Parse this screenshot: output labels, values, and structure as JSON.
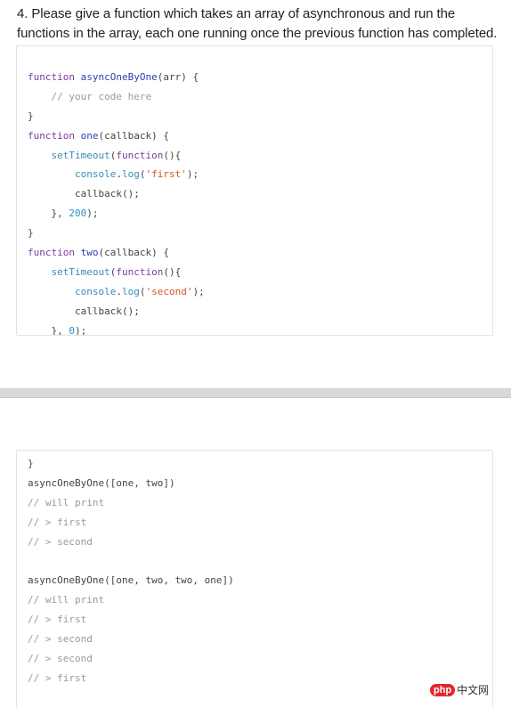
{
  "question": {
    "text": "4. Please give a function which takes an array of asynchronous and run the functions in the array, each one running once the previous function has completed."
  },
  "code_top": [
    [
      {
        "t": "kw",
        "v": "function "
      },
      {
        "t": "fn",
        "v": "asyncOneByOne"
      },
      {
        "t": "plain",
        "v": "(arr) {"
      }
    ],
    [
      {
        "t": "cm",
        "v": "    // your code here"
      }
    ],
    [
      {
        "t": "plain",
        "v": "}"
      }
    ],
    [
      {
        "t": "kw",
        "v": "function "
      },
      {
        "t": "fn",
        "v": "one"
      },
      {
        "t": "plain",
        "v": "(callback) {"
      }
    ],
    [
      {
        "t": "call",
        "v": "    setTimeout"
      },
      {
        "t": "plain",
        "v": "("
      },
      {
        "t": "kw",
        "v": "function"
      },
      {
        "t": "plain",
        "v": "(){"
      }
    ],
    [
      {
        "t": "call",
        "v": "        console"
      },
      {
        "t": "plain",
        "v": "."
      },
      {
        "t": "call",
        "v": "log"
      },
      {
        "t": "plain",
        "v": "("
      },
      {
        "t": "str",
        "v": "'first'"
      },
      {
        "t": "plain",
        "v": ");"
      }
    ],
    [
      {
        "t": "plain",
        "v": "        callback();"
      }
    ],
    [
      {
        "t": "plain",
        "v": "    }, "
      },
      {
        "t": "num",
        "v": "200"
      },
      {
        "t": "plain",
        "v": ");"
      }
    ],
    [
      {
        "t": "plain",
        "v": "}"
      }
    ],
    [
      {
        "t": "kw",
        "v": "function "
      },
      {
        "t": "fn",
        "v": "two"
      },
      {
        "t": "plain",
        "v": "(callback) {"
      }
    ],
    [
      {
        "t": "call",
        "v": "    setTimeout"
      },
      {
        "t": "plain",
        "v": "("
      },
      {
        "t": "kw",
        "v": "function"
      },
      {
        "t": "plain",
        "v": "(){"
      }
    ],
    [
      {
        "t": "call",
        "v": "        console"
      },
      {
        "t": "plain",
        "v": "."
      },
      {
        "t": "call",
        "v": "log"
      },
      {
        "t": "plain",
        "v": "("
      },
      {
        "t": "str",
        "v": "'second'"
      },
      {
        "t": "plain",
        "v": ");"
      }
    ],
    [
      {
        "t": "plain",
        "v": "        callback();"
      }
    ],
    [
      {
        "t": "plain",
        "v": "    }, "
      },
      {
        "t": "num",
        "v": "0"
      },
      {
        "t": "plain",
        "v": ");"
      }
    ]
  ],
  "code_bottom": [
    [
      {
        "t": "plain",
        "v": "}"
      }
    ],
    [
      {
        "t": "plain",
        "v": "asyncOneByOne([one, two])"
      }
    ],
    [
      {
        "t": "cm",
        "v": "// will print"
      }
    ],
    [
      {
        "t": "cm",
        "v": "// > first"
      }
    ],
    [
      {
        "t": "cm",
        "v": "// > second"
      }
    ],
    [
      {
        "t": "plain",
        "v": ""
      }
    ],
    [
      {
        "t": "plain",
        "v": "asyncOneByOne([one, two, two, one])"
      }
    ],
    [
      {
        "t": "cm",
        "v": "// will print"
      }
    ],
    [
      {
        "t": "cm",
        "v": "// > first"
      }
    ],
    [
      {
        "t": "cm",
        "v": "// > second"
      }
    ],
    [
      {
        "t": "cm",
        "v": "// > second"
      }
    ],
    [
      {
        "t": "cm",
        "v": "// > first"
      }
    ]
  ],
  "watermark": {
    "logo": "php",
    "text": "中文网"
  },
  "colors": {
    "keyword": "#7a3e9d",
    "function_name": "#2a3fb0",
    "string": "#d9541e",
    "number": "#2f8fc4",
    "comment": "#999999",
    "separator": "#d9d9d9"
  }
}
